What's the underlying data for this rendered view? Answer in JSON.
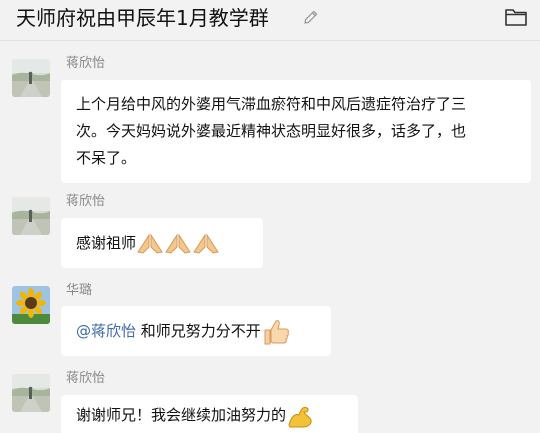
{
  "header": {
    "title": "天师府祝由甲辰年1月教学群",
    "edit_icon": "pencil-icon",
    "folder_icon": "folder-icon"
  },
  "messages": [
    {
      "sender": "蒋欣怡",
      "avatar": "road-landscape-avatar",
      "lines": [
        "上个月给中风的外婆用气滞血瘀符和中风后遗症符治疗了三",
        "次。今天妈妈说外婆最近精神状态明显好很多，话多了，也",
        "不呆了。"
      ]
    },
    {
      "sender": "蒋欣怡",
      "avatar": "road-landscape-avatar",
      "text": "感谢祖师",
      "emojis": [
        "folded-hands-emoji",
        "folded-hands-emoji",
        "folded-hands-emoji"
      ]
    },
    {
      "sender": "华璐",
      "avatar": "sunflower-avatar",
      "mention": "@蒋欣怡",
      "text": " 和师兄努力分不开",
      "emojis": [
        "thumbs-up-emoji"
      ]
    },
    {
      "sender": "蒋欣怡",
      "avatar": "road-landscape-avatar",
      "text": "谢谢师兄！我会继续加油努力的",
      "emojis": [
        "flexed-biceps-emoji"
      ]
    }
  ]
}
